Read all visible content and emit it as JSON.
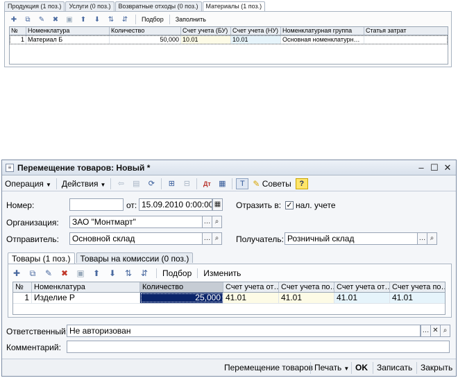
{
  "fragment": {
    "tabs": [
      {
        "label": "Продукция (1 поз.)",
        "active": false
      },
      {
        "label": "Услуги (0 поз.)",
        "active": false
      },
      {
        "label": "Возвратные отходы (0 поз.)",
        "active": false
      },
      {
        "label": "Материалы (1 поз.)",
        "active": true
      }
    ],
    "toolbar": {
      "select_label": "Подбор",
      "fill_label": "Заполнить"
    },
    "table": {
      "headers": [
        "№",
        "Номенклатура",
        "Количество",
        "Счет учета (БУ)",
        "Счет учета (НУ)",
        "Номенклатурная группа",
        "Статья затрат"
      ],
      "rows": [
        [
          "1",
          "Материал Б",
          "50,000",
          "10.01",
          "10.01",
          "Основная номенклатурн…",
          ""
        ]
      ]
    }
  },
  "window": {
    "title": "Перемещение товаров: Новый *",
    "commandbar": {
      "operation": "Операция",
      "actions": "Действия",
      "tips": "Советы",
      "help": "?"
    },
    "form": {
      "number_label": "Номер:",
      "number_value": "",
      "date_label": "от:",
      "date_value": "15.09.2010  0:00:00",
      "reflect_label": "Отразить в:",
      "tax_checkbox_label": "нал. учете",
      "tax_checked": true,
      "org_label": "Организация:",
      "org_value": "ЗАО \"Монтмарт\"",
      "sender_label": "Отправитель:",
      "sender_value": "Основной склад",
      "receiver_label": "Получатель:",
      "receiver_value": "Розничный склад"
    },
    "tabs": [
      {
        "label": "Товары (1 поз.)",
        "active": true
      },
      {
        "label": "Товары на комиссии (0 поз.)",
        "active": false
      }
    ],
    "table_toolbar": {
      "select_label": "Подбор",
      "change_label": "Изменить"
    },
    "table": {
      "headers": [
        "№",
        "Номенклатура",
        "Количество",
        "Счет учета от…",
        "Счет учета по…",
        "Счет учета от…",
        "Счет учета по…"
      ],
      "rows": [
        [
          "1",
          "Изделие Р",
          "25,000",
          "41.01",
          "41.01",
          "41.01",
          "41.01"
        ]
      ]
    },
    "responsible_label": "Ответственный:",
    "responsible_value": "Не авторизован",
    "comment_label": "Комментарий:",
    "comment_value": "",
    "bottom": {
      "print_form": "Перемещение товаров",
      "print": "Печать",
      "ok": "OK",
      "save": "Записать",
      "close": "Закрыть"
    }
  }
}
